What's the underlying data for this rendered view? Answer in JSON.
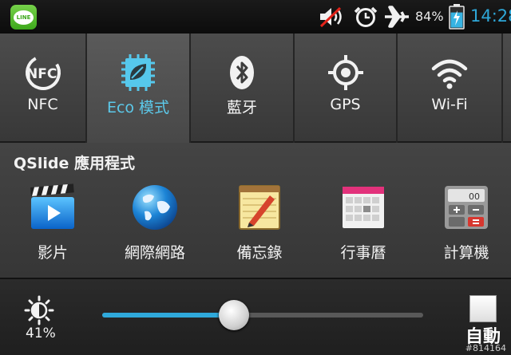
{
  "status_bar": {
    "line_icon_text": "LINE",
    "icons": [
      "line-app-icon",
      "volume-muted-icon",
      "alarm-clock-icon",
      "airplane-mode-icon",
      "battery-charging-icon"
    ],
    "battery": "84%",
    "battery_level": 0.84,
    "time": "14:28",
    "accent_color": "#2ea7d8"
  },
  "toggles": [
    {
      "label": "NFC",
      "icon": "nfc-icon",
      "active": false
    },
    {
      "label": "Eco 模式",
      "icon": "eco-mode-icon",
      "active": true
    },
    {
      "label": "藍牙",
      "icon": "bluetooth-icon",
      "active": false
    },
    {
      "label": "GPS",
      "icon": "gps-icon",
      "active": false
    },
    {
      "label": "Wi-Fi",
      "icon": "wifi-icon",
      "active": false
    }
  ],
  "qslide": {
    "title": "QSlide 應用程式",
    "apps": [
      {
        "label": "影片",
        "icon": "video-icon"
      },
      {
        "label": "網際網路",
        "icon": "internet-globe-icon"
      },
      {
        "label": "備忘錄",
        "icon": "memo-icon"
      },
      {
        "label": "行事曆",
        "icon": "calendar-icon"
      },
      {
        "label": "計算機",
        "icon": "calculator-icon"
      }
    ]
  },
  "brightness": {
    "percent_label": "41%",
    "value": 0.41,
    "auto_label": "自動",
    "auto_checked": false
  },
  "watermark": "#814164"
}
